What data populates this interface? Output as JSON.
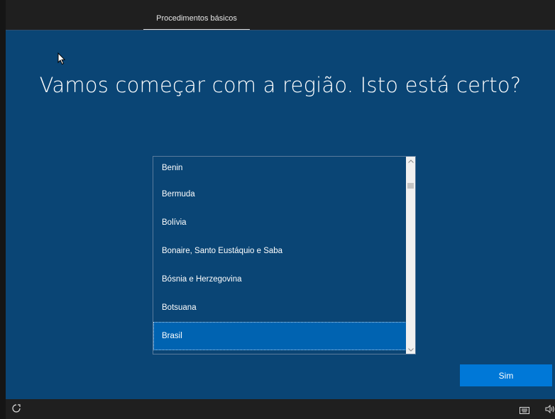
{
  "topbar": {
    "tab_label": "Procedimentos básicos"
  },
  "main": {
    "heading": "Vamos começar com a região. Isto está certo?",
    "region_list": {
      "items": [
        "Benin",
        "Bermuda",
        "Bolívia",
        "Bonaire, Santo Eustáquio e Saba",
        "Bósnia e Herzegovina",
        "Botsuana",
        "Brasil"
      ],
      "selected": "Brasil"
    },
    "confirm_button": "Sim"
  },
  "icons": {
    "cursor": "mouse-pointer-icon",
    "accessibility": "ease-of-access-icon",
    "keyboard": "keyboard-icon",
    "volume": "volume-icon",
    "scroll_up": "chevron-up-icon",
    "scroll_down": "chevron-down-icon"
  },
  "colors": {
    "background": "#0a4575",
    "selected_item": "#0063b1",
    "button": "#0078d7",
    "bar": "#1f1f1f"
  }
}
